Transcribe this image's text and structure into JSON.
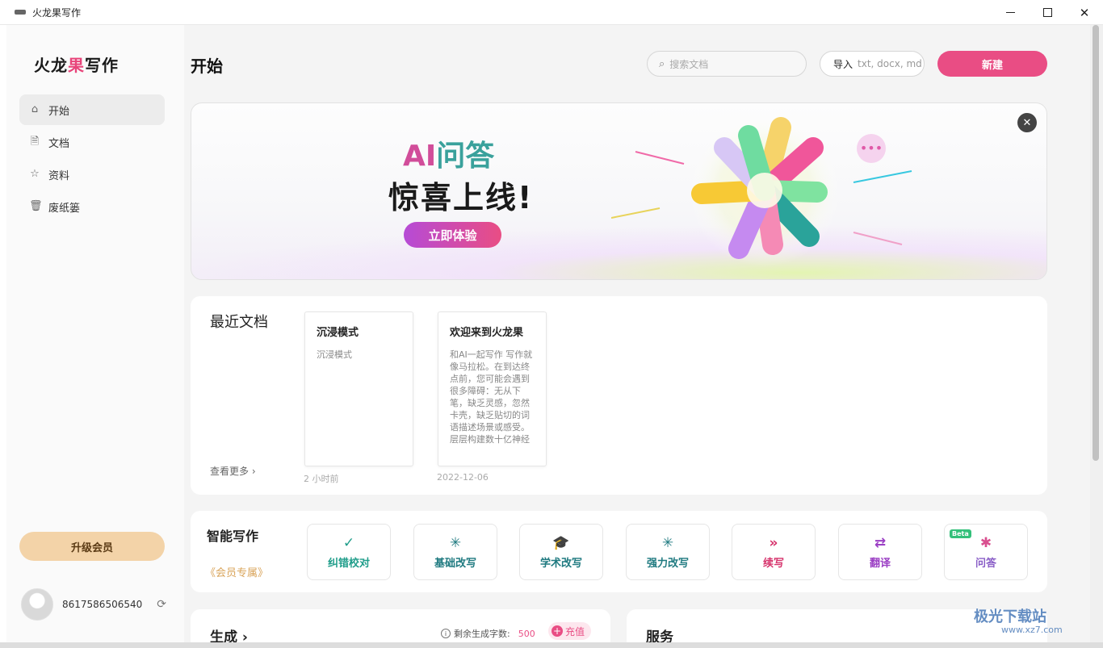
{
  "window": {
    "title": "火龙果写作"
  },
  "sidebar": {
    "logo": "火龙果写作",
    "items": [
      {
        "label": "开始",
        "icon": "home-icon"
      },
      {
        "label": "文档",
        "icon": "document-icon"
      },
      {
        "label": "资料",
        "icon": "star-icon"
      },
      {
        "label": "废纸篓",
        "icon": "trash-icon"
      }
    ],
    "upgrade_label": "升级会员",
    "user_phone": "8617586506540"
  },
  "header": {
    "title": "开始",
    "search_placeholder": "搜索文档",
    "import_label": "导入",
    "import_formats": "txt, docx, md",
    "new_label": "新建"
  },
  "banner": {
    "line1_ai": "AI",
    "line1_rest": "问答",
    "line2": "惊喜上线!",
    "cta": "立即体验"
  },
  "recent": {
    "heading": "最近文档",
    "more": "查看更多",
    "docs": [
      {
        "title": "沉浸模式",
        "body": "沉浸模式",
        "date": "2 小时前"
      },
      {
        "title": "欢迎来到火龙果",
        "body": "和AI一起写作 写作就像马拉松。在到达终点前，您可能会遇到很多障碍：无从下笔，缺乏灵感，忽然卡壳，缺乏贴切的词语描述场景或感受。 层层构建数十亿神经",
        "date": "2022-12-06"
      }
    ]
  },
  "smart_writing": {
    "heading": "智能写作",
    "member_tag": "《会员专属》",
    "tools": [
      {
        "label": "纠错校对",
        "icon": "check-icon",
        "glyph": "✓",
        "color": "#1f9d8a"
      },
      {
        "label": "基础改写",
        "icon": "sparkle-icon",
        "glyph": "✳",
        "color": "#1f7a80"
      },
      {
        "label": "学术改写",
        "icon": "graduation-cap-icon",
        "glyph": "🎓",
        "color": "#1f7a80"
      },
      {
        "label": "强力改写",
        "icon": "sparkle-icon",
        "glyph": "✳",
        "color": "#1f7a80"
      },
      {
        "label": "续写",
        "icon": "double-chevron-icon",
        "glyph": "»",
        "color": "#d6336c"
      },
      {
        "label": "翻译",
        "icon": "swap-arrows-icon",
        "glyph": "⇄",
        "color": "#9b3fc4"
      },
      {
        "label": "问答",
        "icon": "qa-star-icon",
        "glyph": "✱",
        "color": "#8a5fc7",
        "badge": "Beta"
      }
    ]
  },
  "generate": {
    "heading": "生成",
    "remain_label": "剩余生成字数:",
    "remain_value": "500",
    "recharge": "充值"
  },
  "service": {
    "heading": "服务"
  },
  "watermark": {
    "text": "极光下载站",
    "url": "www.xz7.com"
  }
}
